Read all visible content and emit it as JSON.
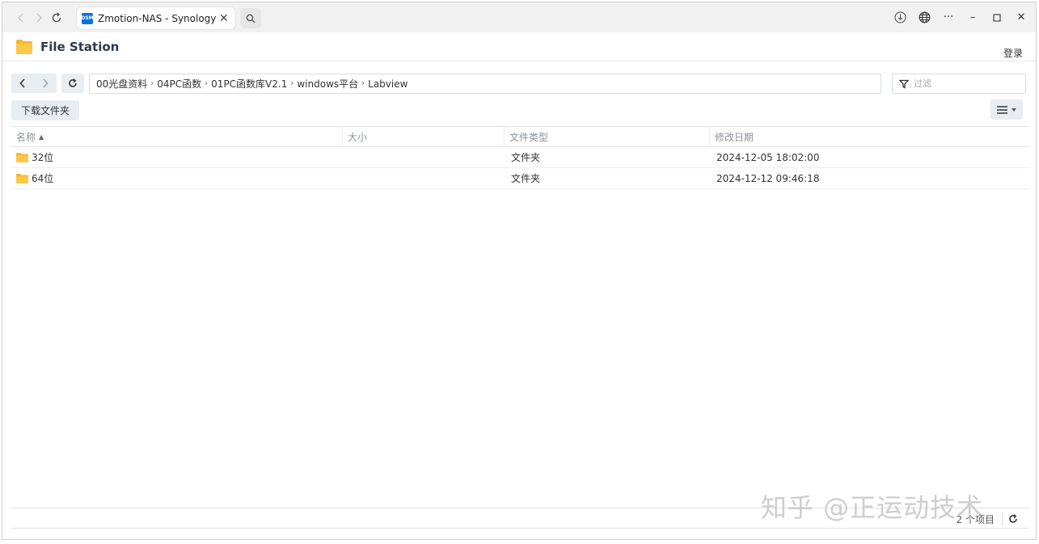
{
  "browser": {
    "tab_title": "Zmotion-NAS - Synology N",
    "favicon_text": "DSM"
  },
  "app": {
    "title": "File Station",
    "login": "登录"
  },
  "toolbar": {
    "breadcrumb": [
      "00光盘资料",
      "04PC函数",
      "01PC函数库V2.1",
      "windows平台",
      "Labview"
    ],
    "filter_placeholder": "过滤",
    "download_label": "下载文件夹"
  },
  "table": {
    "headers": {
      "name": "名称",
      "size": "大小",
      "type": "文件类型",
      "date": "修改日期"
    },
    "rows": [
      {
        "name": "32位",
        "size": "",
        "type": "文件夹",
        "date": "2024-12-05 18:02:00"
      },
      {
        "name": "64位",
        "size": "",
        "type": "文件夹",
        "date": "2024-12-12 09:46:18"
      }
    ]
  },
  "footer": {
    "count": "2 个项目"
  },
  "watermark": "知乎 @正运动技术",
  "colors": {
    "folder": "#f5b731",
    "favicon": "#0b74d6",
    "button_bg": "#e8edf2"
  }
}
